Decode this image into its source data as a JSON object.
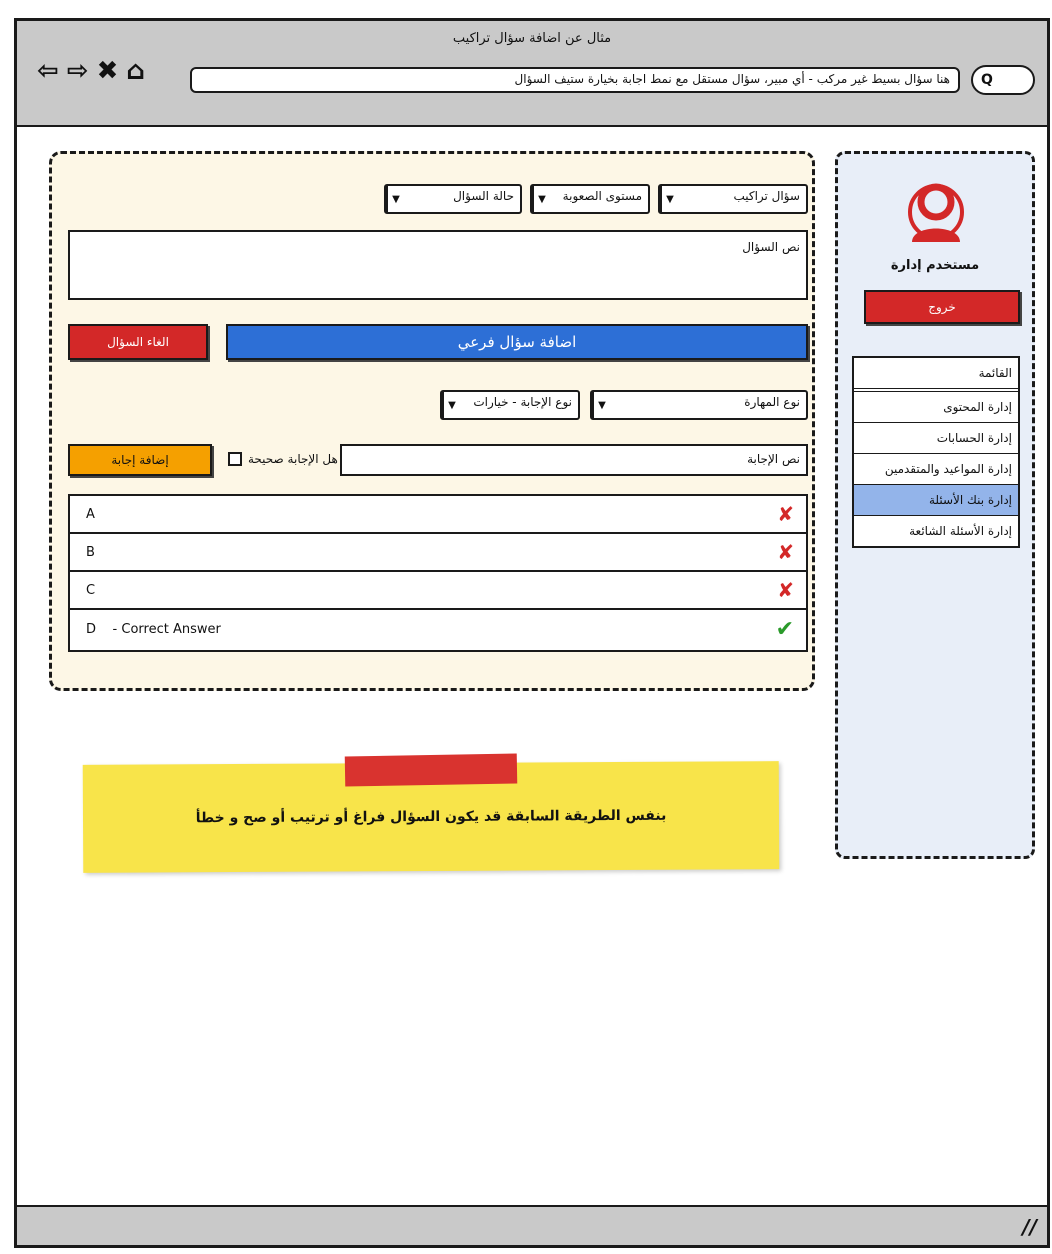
{
  "window": {
    "title": "مثال عن اضافة سؤال تراكيب",
    "url": "هنا سؤال بسيط غير مركب - أي مبير، سؤال مستقل مع نمط اجابة بخيارة ستيف السؤال",
    "search_label": "Q"
  },
  "nav_icons": [
    "back-icon",
    "forward-icon",
    "close-icon",
    "home-icon"
  ],
  "form": {
    "filters": {
      "type": "سؤال تراكيب",
      "difficulty": "مستوى الصعوبة",
      "status": "حالة السؤال"
    },
    "question_text_placeholder": "نص السؤال",
    "cancel_question": "الغاء السؤال",
    "add_subquestion": "اضافة سؤال فرعي",
    "skill_type": "نوع المهارة",
    "answer_type": "نوع الإجابة - خيارات",
    "answer_text_placeholder": "نص الإجابة",
    "is_correct_label": "هل الإجابة صحيحة",
    "add_answer": "إضافة إجابة",
    "answers": [
      {
        "label": "A",
        "correct": false
      },
      {
        "label": "B",
        "correct": false
      },
      {
        "label": "C",
        "correct": false
      },
      {
        "label": "D    - Correct Answer",
        "correct": true
      }
    ]
  },
  "sidebar": {
    "user_name": "مستخدم إدارة",
    "logout": "خروج",
    "menu": [
      {
        "label": "القائمة",
        "active": false
      },
      {
        "label": "إدارة المحتوى",
        "active": false
      },
      {
        "label": "إدارة الحسابات",
        "active": false
      },
      {
        "label": "إدارة المواعيد والمتقدمين",
        "active": false
      },
      {
        "label": "إدارة بنك الأسئلة",
        "active": true
      },
      {
        "label": "إدارة الأسئلة الشائعة",
        "active": false
      }
    ]
  },
  "note": {
    "text": "بنفس الطريقة السابقة قد يكون السؤال فراغ أو ترتيب أو صح  و خطأ"
  },
  "colors": {
    "accent_blue": "#2d6fd6",
    "danger_red": "#d32828",
    "warning_orange": "#f5a000",
    "note_yellow": "#f8e44a",
    "active_menu": "#93b4ea"
  }
}
